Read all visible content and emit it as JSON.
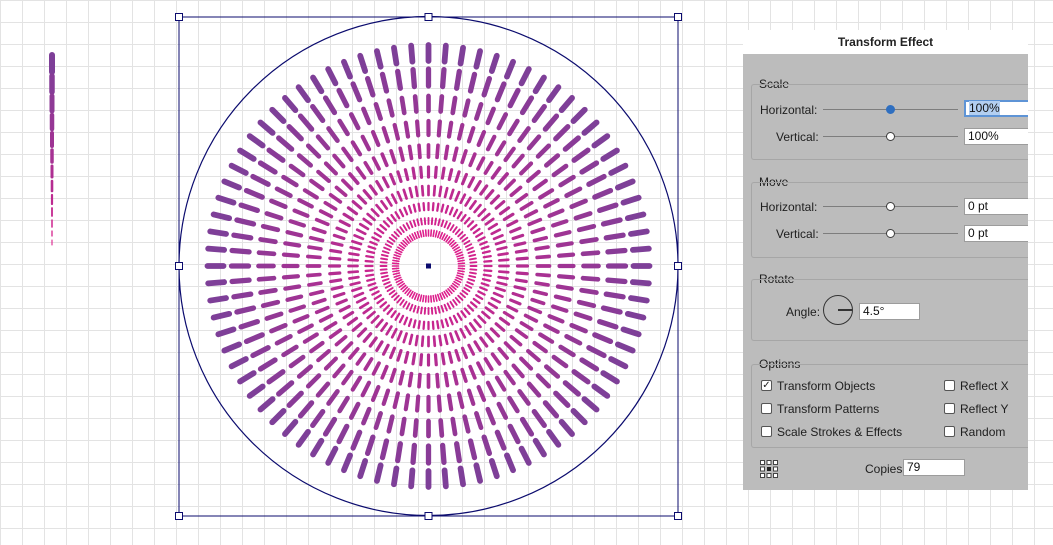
{
  "panel": {
    "title": "Transform Effect",
    "scale": {
      "label": "Scale",
      "horizontal_label": "Horizontal:",
      "horizontal_value": "100%",
      "vertical_label": "Vertical:",
      "vertical_value": "100%"
    },
    "move": {
      "label": "Move",
      "horizontal_label": "Horizontal:",
      "horizontal_value": "0 pt",
      "vertical_label": "Vertical:",
      "vertical_value": "0 pt"
    },
    "rotate": {
      "label": "Rotate",
      "angle_label": "Angle:",
      "angle_value": "4.5°"
    },
    "options": {
      "label": "Options",
      "transform_objects": {
        "label": "Transform Objects",
        "checked": true
      },
      "transform_patterns": {
        "label": "Transform Patterns",
        "checked": false
      },
      "scale_strokes": {
        "label": "Scale Strokes & Effects",
        "checked": false
      },
      "reflect_x": {
        "label": "Reflect X",
        "checked": false
      },
      "reflect_y": {
        "label": "Reflect Y",
        "checked": false
      },
      "random": {
        "label": "Random",
        "checked": false
      }
    },
    "copies_label": "Copies",
    "copies_value": "79"
  },
  "artwork": {
    "dash_color_outer": "#7e3f98",
    "dash_color_inner": "#dd1f8c",
    "selection_color": "#0b0b6e",
    "rings": 10,
    "dashes_per_ring": 80
  }
}
